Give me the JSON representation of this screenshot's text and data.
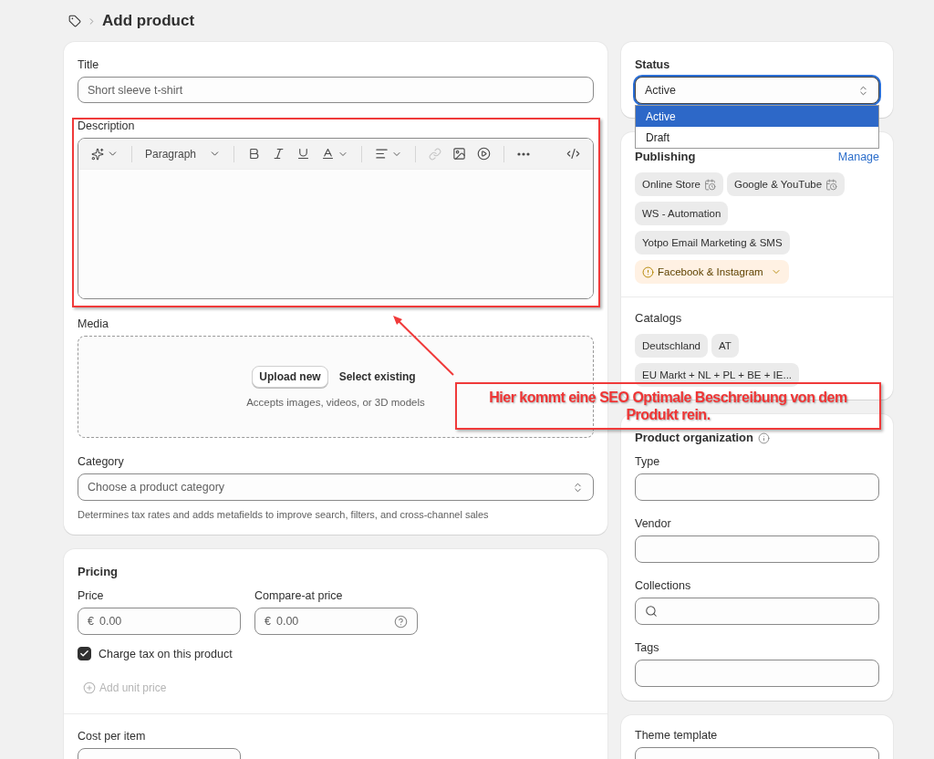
{
  "breadcrumb": {
    "title": "Add product"
  },
  "product_card": {
    "title_field": {
      "label": "Title",
      "placeholder": "Short sleeve t-shirt"
    },
    "description": {
      "label": "Description",
      "paragraph": "Paragraph"
    },
    "media": {
      "label": "Media",
      "upload_button": "Upload new",
      "select_link": "Select existing",
      "hint": "Accepts images, videos, or 3D models"
    },
    "category": {
      "label": "Category",
      "placeholder": "Choose a product category",
      "help": "Determines tax rates and adds metafields to improve search, filters, and cross-channel sales"
    }
  },
  "pricing_card": {
    "title": "Pricing",
    "price": {
      "label": "Price",
      "currency": "€",
      "placeholder": "0.00"
    },
    "compare_price": {
      "label": "Compare-at price",
      "currency": "€",
      "placeholder": "0.00"
    },
    "charge_tax": {
      "label": "Charge tax on this product",
      "checked": true
    },
    "add_unit_price": {
      "label": "Add unit price",
      "disabled": true
    },
    "cost_per_item": {
      "label": "Cost per item"
    }
  },
  "status_card": {
    "label": "Status",
    "value": "Active",
    "options": [
      {
        "label": "Active",
        "selected": true
      },
      {
        "label": "Draft",
        "selected": false
      }
    ]
  },
  "publishing_card": {
    "title": "Publishing",
    "manage_link": "Manage",
    "channels": [
      {
        "label": "Online Store",
        "kind": "scheduled"
      },
      {
        "label": "Google & YouTube",
        "kind": "scheduled"
      },
      {
        "label": "WS - Automation",
        "kind": "plain"
      },
      {
        "label": "Yotpo Email Marketing & SMS",
        "kind": "plain"
      },
      {
        "label": "Facebook & Instagram",
        "kind": "warning"
      }
    ],
    "catalogs_title": "Catalogs",
    "catalogs": [
      "Deutschland",
      "AT",
      "EU Markt + NL + PL + BE + IE..."
    ]
  },
  "organization_card": {
    "title": "Product organization",
    "fields": [
      {
        "label": "Type",
        "kind": "text"
      },
      {
        "label": "Vendor",
        "kind": "text"
      },
      {
        "label": "Collections",
        "kind": "search"
      },
      {
        "label": "Tags",
        "kind": "text"
      }
    ]
  },
  "theme_card": {
    "label": "Theme template"
  },
  "annotation": {
    "text": "Hier kommt eine SEO Optimale Beschreibung von dem Produkt rein."
  }
}
